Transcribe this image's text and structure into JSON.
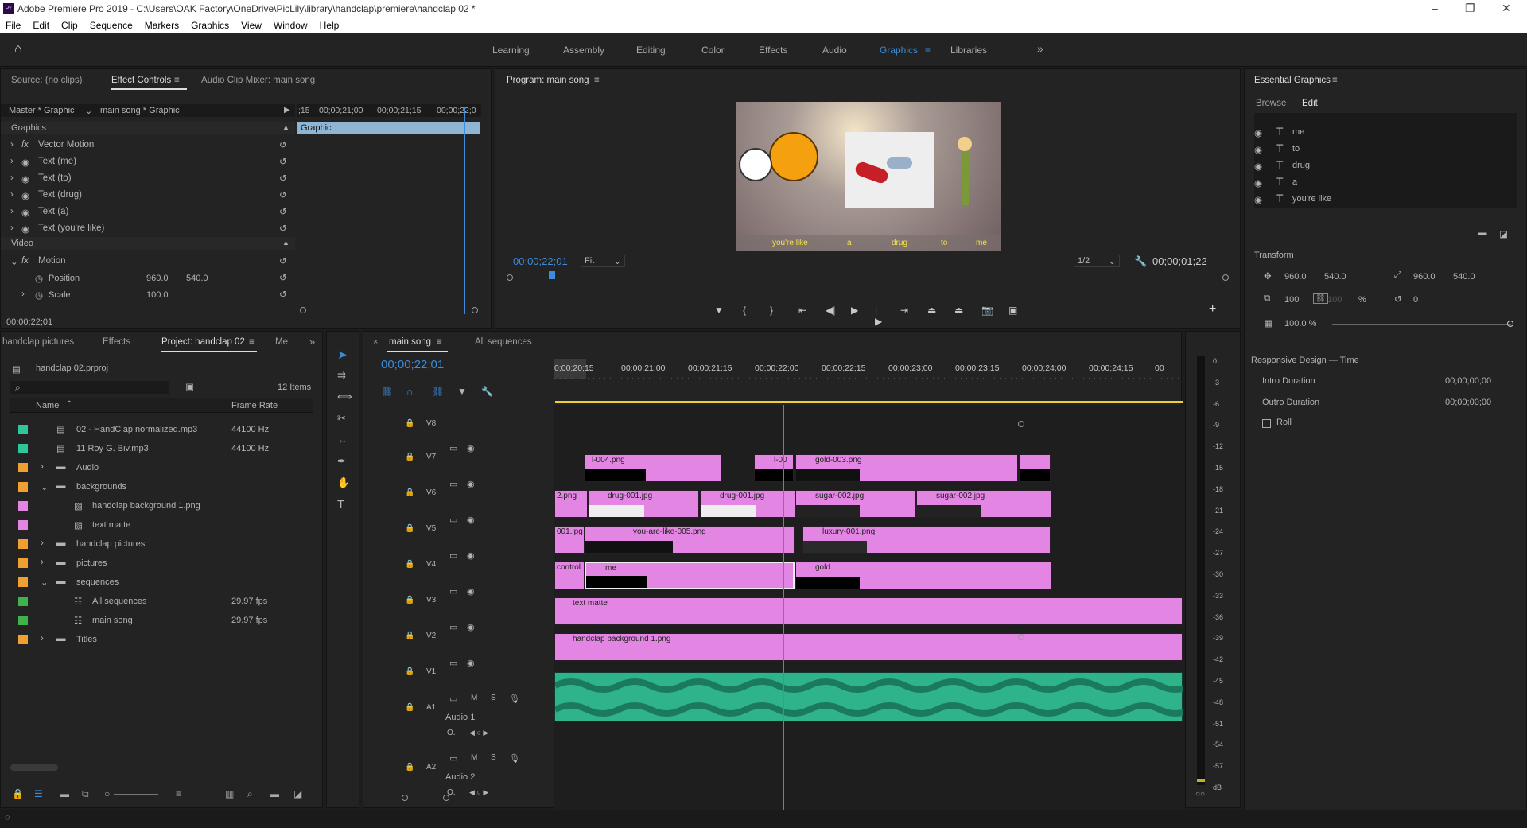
{
  "app": {
    "title": "Adobe Premiere Pro 2019 - C:\\Users\\OAK Factory\\OneDrive\\PicLily\\library\\handclap\\premiere\\handclap 02 *"
  },
  "menu": [
    "File",
    "Edit",
    "Clip",
    "Sequence",
    "Markers",
    "Graphics",
    "View",
    "Window",
    "Help"
  ],
  "workspaces": [
    "Learning",
    "Assembly",
    "Editing",
    "Color",
    "Effects",
    "Audio",
    "Graphics",
    "Libraries"
  ],
  "active_workspace": "Graphics",
  "source_panel": {
    "tabs": [
      "Source: (no clips)",
      "Effect Controls",
      "Audio Clip Mixer: main song"
    ],
    "master": "Master * Graphic",
    "clip": "main song * Graphic",
    "ruler": [
      ";15",
      "00;00;21;00",
      "00;00;21;15",
      "00;00;22;0"
    ],
    "graphic_bar": "Graphic",
    "section_graphics": "Graphics",
    "section_video": "Video",
    "rows": [
      {
        "label": "Vector Motion"
      },
      {
        "label": "Text (me)"
      },
      {
        "label": "Text (to)"
      },
      {
        "label": "Text (drug)"
      },
      {
        "label": "Text (a)"
      },
      {
        "label": "Text (you're like)"
      }
    ],
    "motion": "Motion",
    "position_label": "Position",
    "position_x": "960.0",
    "position_y": "540.0",
    "scale_label": "Scale",
    "scale_value": "100.0",
    "timecode": "00;00;22;01"
  },
  "program": {
    "title": "Program: main song",
    "timecode": "00;00;22;01",
    "fit": "Fit",
    "quality": "1/2",
    "duration": "00;00;01;22",
    "captions": [
      "you're like",
      "a",
      "drug",
      "to",
      "me"
    ]
  },
  "essential": {
    "title": "Essential Graphics",
    "tabs": [
      "Browse",
      "Edit"
    ],
    "layers": [
      "me",
      "to",
      "drug",
      "a",
      "you're like"
    ],
    "transform": "Transform",
    "pos_x": "960.0",
    "pos_y": "540.0",
    "anchor_x": "960.0",
    "anchor_y": "540.0",
    "scale": "100",
    "scale2": "100",
    "pct": "%",
    "rotation": "0",
    "opacity": "100.0 %",
    "responsive": "Responsive Design — Time",
    "intro": "Intro Duration",
    "intro_val": "00;00;00;00",
    "outro": "Outro Duration",
    "outro_val": "00;00;00;00",
    "roll": "Roll"
  },
  "project": {
    "tabs": [
      "handclap pictures",
      "Effects",
      "Project: handclap 02",
      "Me"
    ],
    "file": "handclap 02.prproj",
    "items": "12 Items",
    "col_name": "Name",
    "col_rate": "Frame Rate",
    "rows": [
      {
        "name": "02 - HandClap normalized.mp3",
        "rate": "44100 Hz",
        "color": "#2fc69a",
        "indent": 0
      },
      {
        "name": "11 Roy G. Biv.mp3",
        "rate": "44100 Hz",
        "color": "#2fc69a",
        "indent": 0
      },
      {
        "name": "Audio",
        "rate": "",
        "color": "#f0a030",
        "indent": 0
      },
      {
        "name": "backgrounds",
        "rate": "",
        "color": "#f0a030",
        "indent": 0
      },
      {
        "name": "handclap background 1.png",
        "rate": "",
        "color": "#e386e3",
        "indent": 1
      },
      {
        "name": "text matte",
        "rate": "",
        "color": "#e386e3",
        "indent": 1
      },
      {
        "name": "handclap pictures",
        "rate": "",
        "color": "#f0a030",
        "indent": 0
      },
      {
        "name": "pictures",
        "rate": "",
        "color": "#f0a030",
        "indent": 0
      },
      {
        "name": "sequences",
        "rate": "",
        "color": "#f0a030",
        "indent": 0
      },
      {
        "name": "All sequences",
        "rate": "29.97 fps",
        "color": "#3fb34a",
        "indent": 1
      },
      {
        "name": "main song",
        "rate": "29.97 fps",
        "color": "#3fb34a",
        "indent": 1
      },
      {
        "name": "Titles",
        "rate": "",
        "color": "#f0a030",
        "indent": 0
      }
    ]
  },
  "timeline": {
    "tabs": [
      "main song",
      "All sequences"
    ],
    "timecode": "00;00;22;01",
    "ruler": [
      "0;00;20;15",
      "00;00;21;00",
      "00;00;21;15",
      "00;00;22;00",
      "00;00;22;15",
      "00;00;23;00",
      "00;00;23;15",
      "00;00;24;00",
      "00;00;24;15",
      "00"
    ],
    "tracks": [
      "V8",
      "V7",
      "V6",
      "V5",
      "V4",
      "V3",
      "V2",
      "V1",
      "A1",
      "A2"
    ],
    "audio1": "Audio 1",
    "audio2": "Audio 2",
    "clips": {
      "c1": "l-004.png",
      "c2": "l-00",
      "c3": "gold-003.png",
      "c4": "2.png",
      "c5": "drug-001.jpg",
      "c6": "drug-001.jpg",
      "c7": "sugar-002.jpg",
      "c8": "sugar-002.jpg",
      "c9": "001.jpg",
      "c10": "you-are-like-005.png",
      "c11": "luxury-001.png",
      "c12": "control",
      "c13": "me",
      "c14": "gold",
      "c15": "text matte",
      "c16": "handclap background 1.png"
    }
  },
  "meter": [
    "0",
    "-3",
    "-6",
    "-9",
    "-12",
    "-15",
    "-18",
    "-21",
    "-24",
    "-27",
    "-30",
    "-33",
    "-36",
    "-39",
    "-42",
    "-45",
    "-48",
    "-51",
    "-54",
    "-57",
    "dB"
  ]
}
